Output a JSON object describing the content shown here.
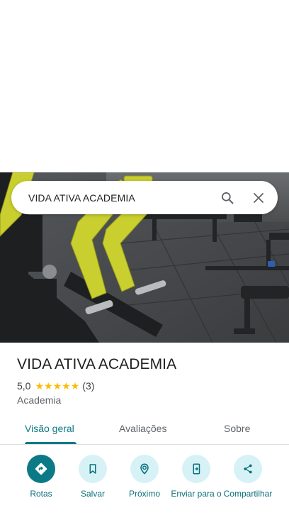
{
  "search": {
    "query": "VIDA ATIVA ACADEMIA"
  },
  "place": {
    "title": "VIDA ATIVA ACADEMIA",
    "rating": "5,0",
    "stars": 5,
    "review_count": "(3)",
    "category": "Academia"
  },
  "tabs": [
    {
      "label": "Visão geral",
      "active": true
    },
    {
      "label": "Avaliações",
      "active": false
    },
    {
      "label": "Sobre",
      "active": false
    }
  ],
  "actions": [
    {
      "label": "Rotas",
      "icon": "directions-icon",
      "primary": true
    },
    {
      "label": "Salvar",
      "icon": "bookmark-icon",
      "primary": false
    },
    {
      "label": "Próximo",
      "icon": "nearby-icon",
      "primary": false
    },
    {
      "label": "Enviar para o",
      "icon": "send-to-phone-icon",
      "primary": false
    },
    {
      "label": "Compartilhar",
      "icon": "share-icon",
      "primary": false
    }
  ],
  "colors": {
    "accent": "#0b7a86",
    "accent_light": "#d7f2f7",
    "star": "#fbbc04",
    "machine_yellow": "#c9cf2f"
  }
}
